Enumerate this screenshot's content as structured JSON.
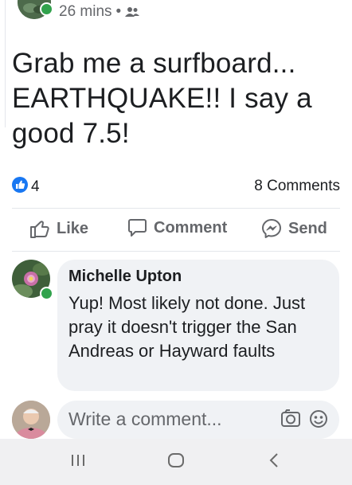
{
  "post": {
    "time": "26 mins",
    "separator": "•",
    "privacy_icon": "friends-icon",
    "text": "Grab me a surfboard... EARTHQUAKE!! I say a good 7.5!",
    "like_count": "4",
    "comments_count": "8 Comments"
  },
  "actions": {
    "like_label": "Like",
    "comment_label": "Comment",
    "send_label": "Send"
  },
  "comment": {
    "author": "Michelle Upton",
    "text": "Yup! Most likely not done. Just pray it doesn't trigger the San Andreas or Hayward faults"
  },
  "composer": {
    "placeholder": "Write a comment..."
  },
  "colors": {
    "brand_blue": "#1877f2",
    "online_green": "#31a24c",
    "bubble": "#f0f2f5",
    "muted_text": "#65676b"
  },
  "nav": {
    "recent_icon": "recent-apps-icon",
    "home_icon": "home-icon",
    "back_icon": "back-icon"
  }
}
